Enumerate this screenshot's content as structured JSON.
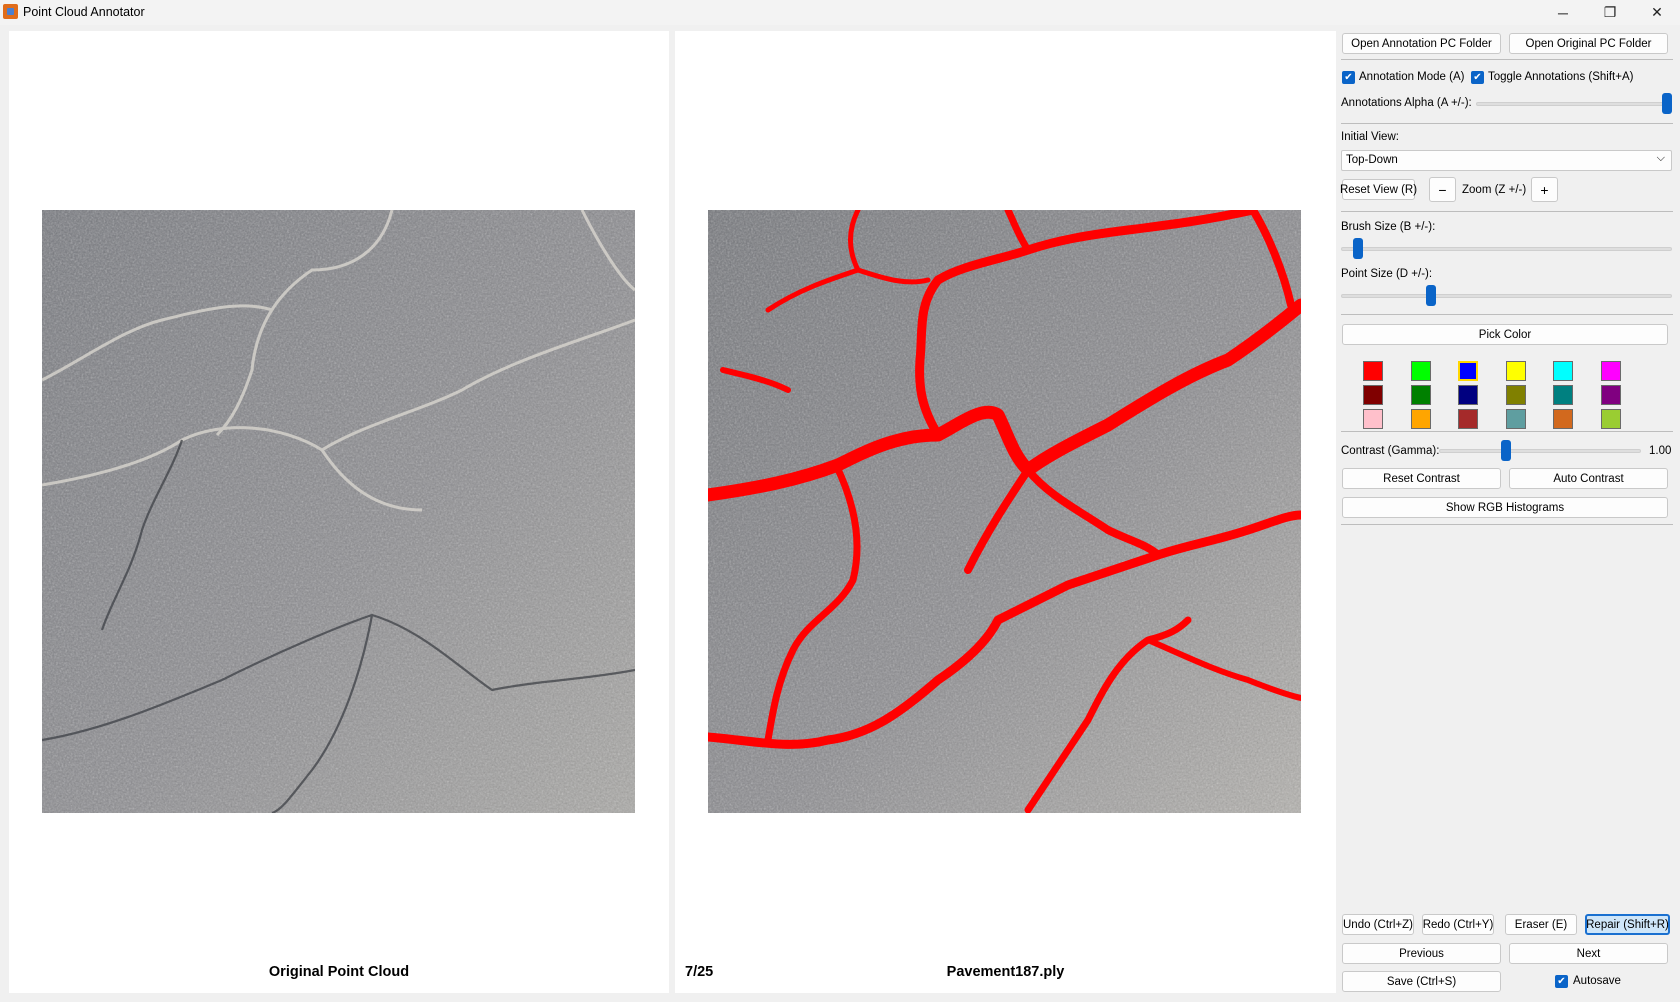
{
  "window": {
    "title": "Point Cloud Annotator",
    "minimize_icon": "─",
    "maximize_icon": "❐",
    "close_icon": "✕"
  },
  "views": {
    "left_label": "Original Point Cloud",
    "frame_counter": "7/25",
    "file_name": "Pavement187.ply"
  },
  "panel": {
    "open_annotation_folder": "Open Annotation PC Folder",
    "open_original_folder": "Open Original PC Folder",
    "annotation_mode": {
      "label": "Annotation Mode (A)",
      "checked": true
    },
    "toggle_annotations": {
      "label": "Toggle Annotations (Shift+A)",
      "checked": true
    },
    "alpha_label": "Annotations Alpha (A +/-):",
    "alpha_level": 1.0,
    "initial_view_label": "Initial View:",
    "initial_view_value": "Top-Down",
    "reset_view": "Reset View (R)",
    "zoom_minus": "−",
    "zoom_label": "Zoom (Z +/-)",
    "zoom_plus": "+",
    "brush_size_label": "Brush Size (B +/-):",
    "brush_size_level": 0.02,
    "point_size_label": "Point Size (D +/-):",
    "point_size_level": 0.27,
    "pick_color": "Pick Color",
    "palette": [
      [
        "#ff0000",
        "#00ff00",
        "#0000ff",
        "#ffff00",
        "#00ffff",
        "#ff00ff"
      ],
      [
        "#800000",
        "#008000",
        "#000080",
        "#808000",
        "#008080",
        "#800080"
      ],
      [
        "#ffc0cb",
        "#ffa500",
        "#a52a2a",
        "#5f9ea0",
        "#d2691e",
        "#9acd32"
      ]
    ],
    "selected_color": "#0000ff",
    "contrast_label": "Contrast (Gamma):",
    "contrast_level": 0.33,
    "contrast_value": "1.00",
    "reset_contrast": "Reset Contrast",
    "auto_contrast": "Auto Contrast",
    "show_histograms": "Show RGB Histograms",
    "undo": "Undo (Ctrl+Z)",
    "redo": "Redo (Ctrl+Y)",
    "eraser": "Eraser (E)",
    "repair": "Repair (Shift+R)",
    "previous": "Previous",
    "next": "Next",
    "save": "Save (Ctrl+S)",
    "autosave": {
      "label": "Autosave",
      "checked": true
    }
  },
  "annotation_color": "#ff0000"
}
